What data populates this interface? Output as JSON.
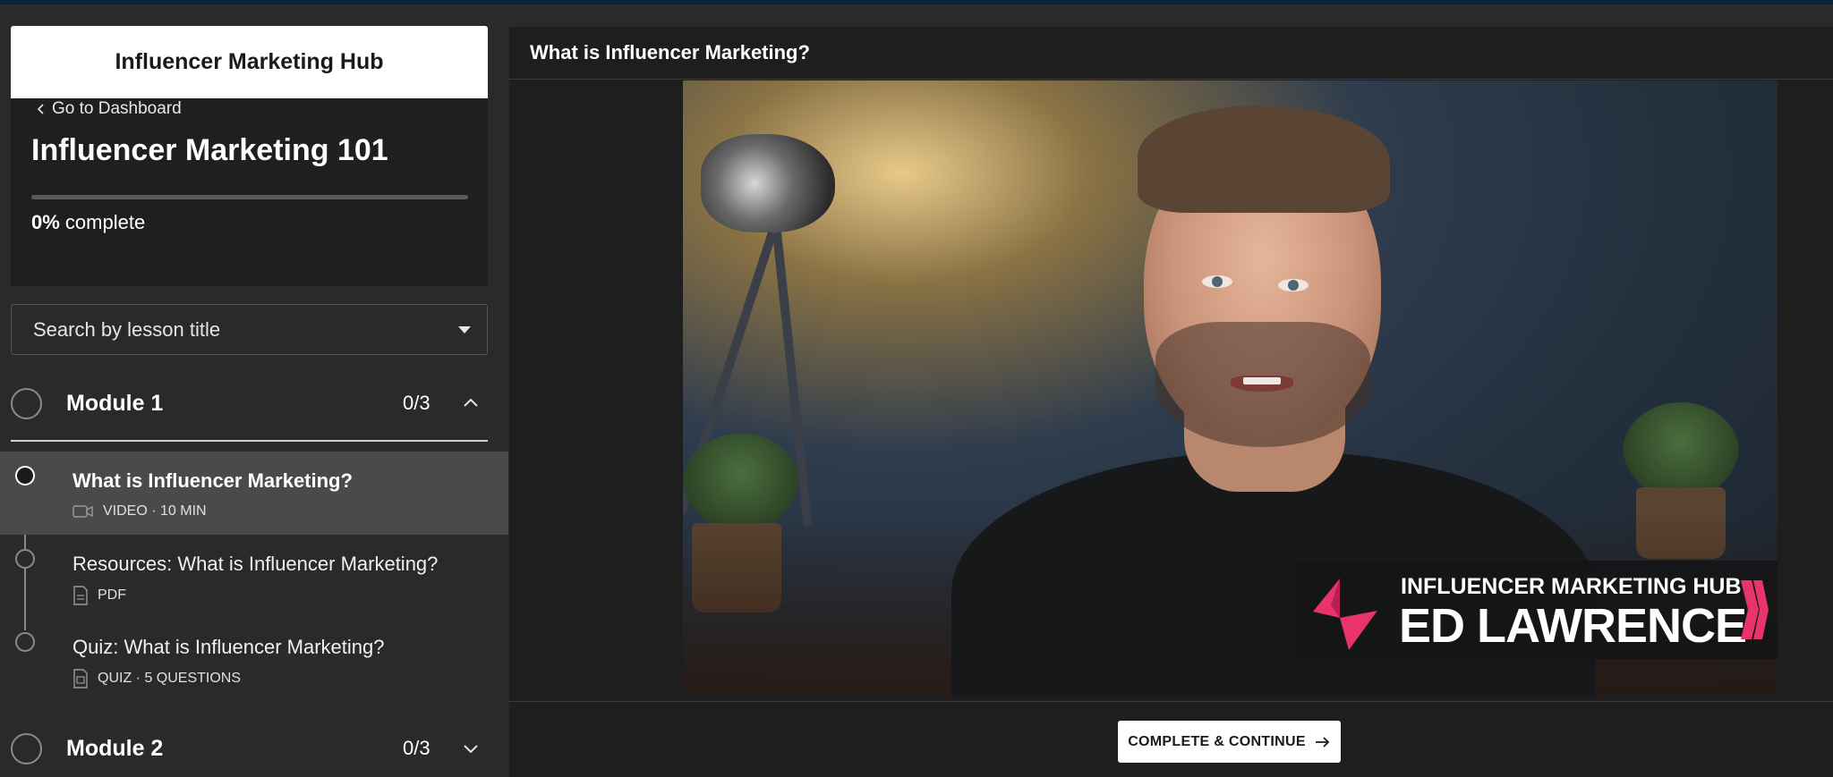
{
  "hub": {
    "name": "Influencer Marketing Hub"
  },
  "course": {
    "back_label": "Go to Dashboard",
    "title": "Influencer Marketing 101",
    "progress_percent": 0,
    "progress_value": "0%",
    "progress_suffix": "complete"
  },
  "search": {
    "placeholder": "Search by lesson title"
  },
  "modules": [
    {
      "title": "Module 1",
      "count": "0/3",
      "expanded": true
    },
    {
      "title": "Module 2",
      "count": "0/3",
      "expanded": false
    }
  ],
  "lessons": [
    {
      "title": "What is Influencer Marketing?",
      "meta": "VIDEO · 10 MIN",
      "icon": "video-icon",
      "active": true
    },
    {
      "title": "Resources: What is Influencer Marketing?",
      "meta": "PDF",
      "icon": "pdf-icon",
      "active": false
    },
    {
      "title": "Quiz: What is Influencer Marketing?",
      "meta": "QUIZ · 5 QUESTIONS",
      "icon": "quiz-icon",
      "active": false
    }
  ],
  "main": {
    "lesson_title": "What is Influencer Marketing?",
    "video": {
      "brand_line": "INFLUENCER MARKETING HUB",
      "presenter_name": "ED LAWRENCE"
    },
    "cta_label": "COMPLETE & CONTINUE"
  },
  "colors": {
    "accent": "#e8336b",
    "panel": "#1e1e1e",
    "sidebar": "#2a2a2a"
  }
}
